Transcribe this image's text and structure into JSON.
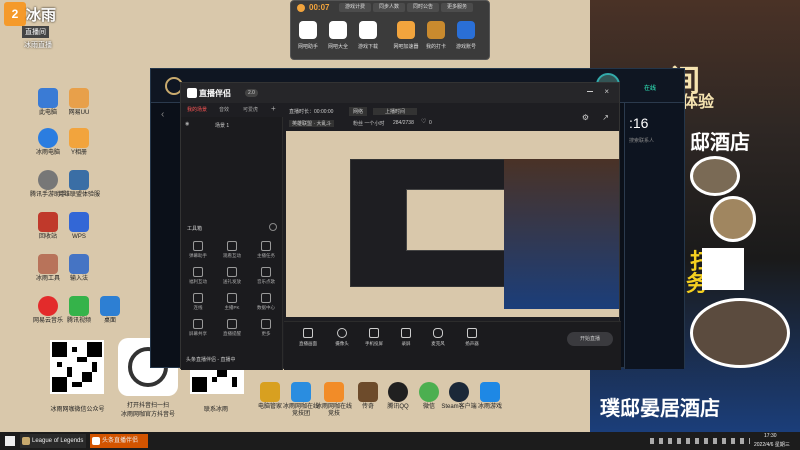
{
  "corner_logo": {
    "line1": "冰雨",
    "line2": "直播间",
    "line3": "冰雨直播"
  },
  "desktop_icons": [
    {
      "label": "此电脑",
      "color": "#3a7bd5"
    },
    {
      "label": "网易UU",
      "color": "#e8a04a"
    },
    {
      "label": "冰雨电脑",
      "color": "#2b7de0"
    },
    {
      "label": "Y相册",
      "color": "#f2a43d"
    },
    {
      "label": "腾讯手游助手",
      "color": "#777"
    },
    {
      "label": "英雄联盟体验服",
      "color": "#3a6ea5"
    },
    {
      "label": "回收站",
      "color": "#c0392b"
    },
    {
      "label": "WPS",
      "color": "#3367d6"
    },
    {
      "label": "冰雨工具",
      "color": "#b8735a"
    },
    {
      "label": "输入法",
      "color": "#4574c4"
    },
    {
      "label": "网易云音乐",
      "color": "#e32b2b"
    },
    {
      "label": "腾讯视频",
      "color": "#35b34a"
    },
    {
      "label": "桌面",
      "color": "#2d7fd3"
    }
  ],
  "qr_captions": {
    "wechat_official": "冰雨网咖微信公众号",
    "mini_program": "打开抖音扫一扫\n冰雨网咖官方抖音号",
    "contact": "联系冰雨"
  },
  "dock_icons": [
    {
      "label": "电脑管家",
      "color": "#d8a020"
    },
    {
      "label": "冰雨网咖在线竞技团",
      "color": "#2a8de0"
    },
    {
      "label": "冰雨网咖在线竞技",
      "color": "#f28c28"
    },
    {
      "label": "传奇",
      "color": "#6d4b2b"
    },
    {
      "label": "腾讯QQ",
      "color": "#202020"
    },
    {
      "label": "微信",
      "color": "#4caf50"
    },
    {
      "label": "Steam客户端",
      "color": "#1b2838"
    },
    {
      "label": "冰雨游戏",
      "color": "#1e88e5"
    }
  ],
  "top_toolbar": {
    "timer": "00:07",
    "btn1": "游戏计费",
    "btn2": "同步人数",
    "btn3": "同时公告",
    "btn4": "更多服务",
    "icon_labels": [
      "网吧助手",
      "网吧大全",
      "游戏下载",
      "网吧加速器",
      "我的打卡",
      "游戏账号"
    ]
  },
  "poster": {
    "title_right": "间",
    "sub": "体验",
    "hotel_big": "璞邸晏居酒店",
    "hotel_small": "邸酒店",
    "mid_char": "扫",
    "side_char": "务"
  },
  "lol_client": {
    "search_text": "搜索联系人",
    "status_text": "在线",
    "time": ":16"
  },
  "stream_app": {
    "logo": "直播伴侣",
    "version": "2.0",
    "tabs": [
      "我的场景",
      "音效",
      "可爱虎"
    ],
    "scene_item": "场景 1",
    "info_line1": "直播时长：00:00:00",
    "info_line2": "上播时间",
    "info_btn": "网络",
    "cat_label": "英雄联盟 · 大乱斗",
    "cat_extra": "粉丝 一个小时",
    "viewers": "284/2738",
    "likes": "0",
    "toolbox_title": "工具箱",
    "tools": [
      "弹幕助手",
      "观看互动",
      "主播任务",
      "福利互动",
      "送礼发放",
      "音乐点歌",
      "连线",
      "主播PK",
      "数据中心",
      "屏幕共享",
      "直播提醒",
      "更多"
    ],
    "bottom_buttons": [
      "直播画面",
      "摄像头",
      "手机投屏",
      "录屏",
      "麦克风",
      "扬声器"
    ],
    "start_button": "开始直播",
    "status_text": "头条直播伴侣 - 直播中"
  },
  "taskbar": {
    "item1": "League of Legends",
    "item2": "头条直播伴侣",
    "time": "17:30",
    "date": "2022/4/6 星期三"
  }
}
